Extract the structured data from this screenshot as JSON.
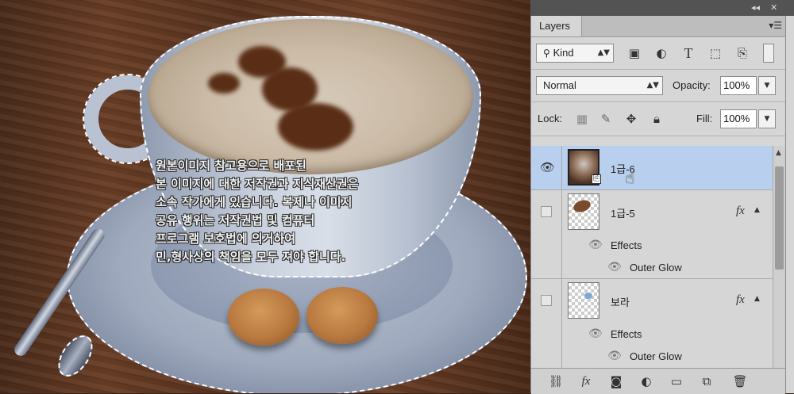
{
  "canvas": {
    "watermark": "원본이미지 참고용으로 배포된\n본 이미지에 대한 저작권과 지식재산권은\n소속 작가에게 있습니다. 복제나 이미지\n공유 행위는 저작권법 및 컴퓨터\n프로그램 보호법에 의거하여\n민,형사상의 책임을 모두 져야 합니다."
  },
  "panel": {
    "tab_label": "Layers",
    "filter": {
      "kind_label": "Kind",
      "kind_icon": "search-icon",
      "icons": [
        "image-filter-icon",
        "adjustment-filter-icon",
        "type-filter-icon",
        "shape-filter-icon",
        "smart-object-filter-icon"
      ]
    },
    "blend_mode": "Normal",
    "opacity_label": "Opacity:",
    "opacity_value": "100%",
    "lock_label": "Lock:",
    "fill_label": "Fill:",
    "fill_value": "100%",
    "layers": [
      {
        "name": "1급-6",
        "visible": true,
        "selected": true,
        "has_fx": false
      },
      {
        "name": "1급-5",
        "visible": false,
        "selected": false,
        "has_fx": true,
        "effects_label": "Effects",
        "effect_items": [
          "Outer Glow"
        ]
      },
      {
        "name": "보라",
        "visible": false,
        "selected": false,
        "has_fx": true,
        "effects_label": "Effects",
        "effect_items": [
          "Outer Glow"
        ]
      }
    ],
    "fx_symbol": "fx",
    "bottom_fx": "fx"
  },
  "colors": {
    "selected_row": "#b8cfee",
    "panel_bg": "#d6d6d6",
    "panel_header": "#535353"
  }
}
